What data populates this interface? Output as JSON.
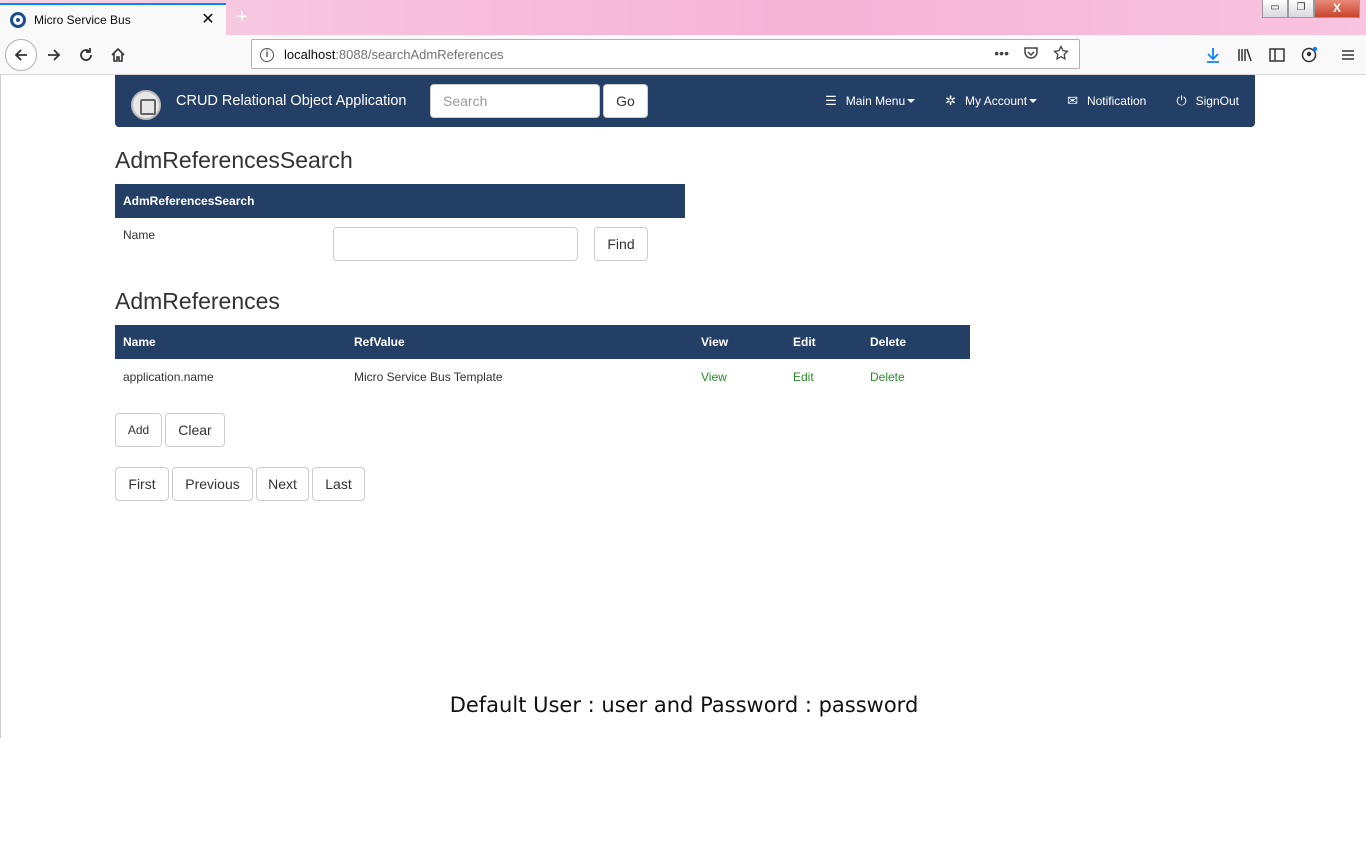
{
  "browser": {
    "tab_title": "Micro Service Bus",
    "tab_close": "✕",
    "new_tab": "+",
    "url_host": "localhost",
    "url_rest": ":8088/searchAdmReferences",
    "url_info": "i",
    "url_more": "•••",
    "window_controls": {
      "minimize": "▭",
      "restore": "❐",
      "close": "X"
    }
  },
  "app": {
    "brand": "CRUD Relational Object Application",
    "search_placeholder": "Search",
    "go_label": "Go",
    "menu": {
      "main_menu": "Main Menu",
      "my_account": "My Account",
      "notification": "Notification",
      "signout": "SignOut"
    }
  },
  "search_section": {
    "title": "AdmReferencesSearch",
    "panel_header": "AdmReferencesSearch",
    "name_label": "Name",
    "name_value": "",
    "find_label": "Find"
  },
  "results_section": {
    "title": "AdmReferences",
    "columns": [
      "Name",
      "RefValue",
      "View",
      "Edit",
      "Delete"
    ],
    "rows": [
      {
        "name": "application.name",
        "ref_value": "Micro Service Bus Template",
        "view": "View",
        "edit": "Edit",
        "delete": "Delete"
      }
    ]
  },
  "actions": {
    "add": "Add",
    "clear": "Clear"
  },
  "pagination": {
    "first": "First",
    "previous": "Previous",
    "next": "Next",
    "last": "Last"
  },
  "footer_note": "Default User : user and Password : password",
  "colors": {
    "nav": "#243f66",
    "link": "#2a8a2a",
    "tab_accent": "#0a84ff"
  }
}
